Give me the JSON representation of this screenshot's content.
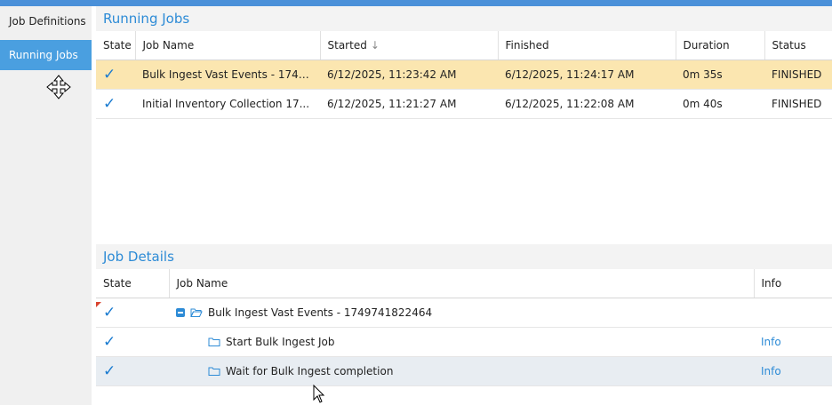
{
  "sidebar": {
    "items": [
      {
        "label": "Job Definitions"
      },
      {
        "label": "Running Jobs"
      }
    ]
  },
  "running_jobs": {
    "title": "Running Jobs",
    "columns": [
      "State",
      "Job Name",
      "Started",
      "Finished",
      "Duration",
      "Status"
    ],
    "rows": [
      {
        "name": "Bulk Ingest Vast Events - 1749...",
        "started": "6/12/2025, 11:23:42 AM",
        "finished": "6/12/2025, 11:24:17 AM",
        "duration": "0m 35s",
        "status": "FINISHED"
      },
      {
        "name": "Initial Inventory Collection 17...",
        "started": "6/12/2025, 11:21:27 AM",
        "finished": "6/12/2025, 11:22:08 AM",
        "duration": "0m 40s",
        "status": "FINISHED"
      }
    ]
  },
  "job_details": {
    "title": "Job Details",
    "columns": [
      "State",
      "Job Name",
      "Info"
    ],
    "rows": [
      {
        "name": "Bulk Ingest Vast Events - 1749741822464",
        "info": ""
      },
      {
        "name": "Start Bulk Ingest Job",
        "info": "Info"
      },
      {
        "name": "Wait for Bulk Ingest completion",
        "info": "Info"
      }
    ]
  },
  "icons": {
    "check": "✓",
    "sort": "↓"
  },
  "colors": {
    "accent": "#2d8bd6",
    "selected_row": "#fbe6b0",
    "sidebar_active": "#4a9fe0"
  }
}
